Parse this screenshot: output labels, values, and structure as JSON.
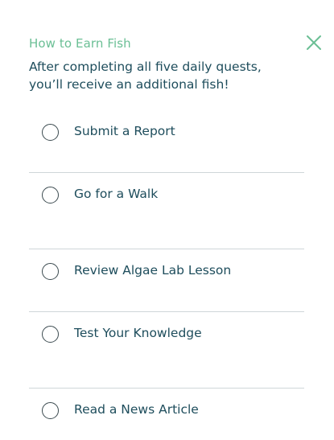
{
  "panel": {
    "title": "How to Earn Fish",
    "description_lines": [
      "After completing all five daily quests,",
      "you’ll receive an additional fish!"
    ],
    "close_icon": "close-icon"
  },
  "quests": [
    {
      "label": "Submit a Report",
      "checked": false
    },
    {
      "label": "Go for a Walk",
      "checked": false
    },
    {
      "label": "Review Algae Lab Lesson",
      "checked": false
    },
    {
      "label": "Test Your Knowledge",
      "checked": false
    },
    {
      "label": "Read a News Article",
      "checked": false
    }
  ],
  "colors": {
    "accent": "#6bbf95",
    "text": "#1e4d5c",
    "divider": "#cfd6d9"
  }
}
